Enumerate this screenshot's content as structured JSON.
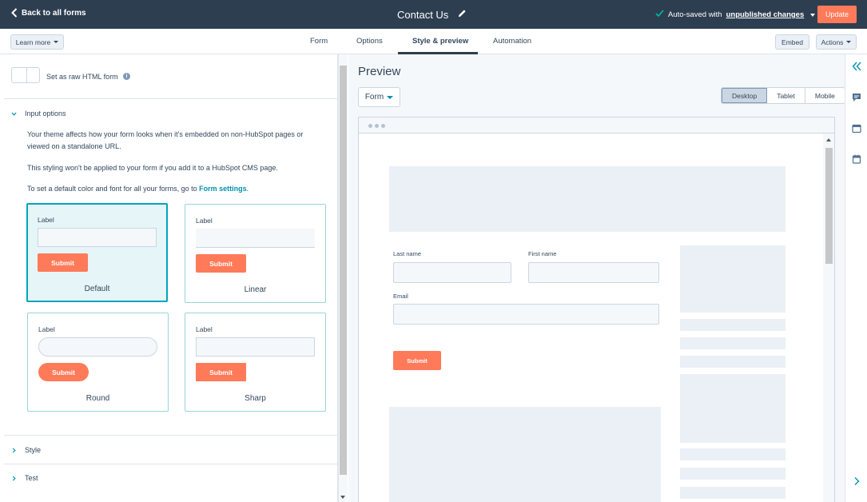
{
  "topbar": {
    "back_label": "Back to all forms",
    "title": "Contact Us",
    "autosave_prefix": "Auto-saved with",
    "autosave_link": "unpublished changes",
    "update_label": "Update"
  },
  "tabbar": {
    "learn_more": "Learn more",
    "tabs": [
      "Form",
      "Options",
      "Style & preview",
      "Automation"
    ],
    "active_tab": "Style & preview",
    "embed": "Embed",
    "actions": "Actions"
  },
  "left": {
    "raw_html_label": "Set as raw HTML form",
    "input_options": "Input options",
    "desc1": "Your theme affects how your form looks when it's embedded on non-HubSpot pages or viewed on a standalone URL.",
    "desc2": "This styling won't be applied to your form if you add it to a HubSpot CMS page.",
    "desc3_prefix": "To set a default color and font for all your forms, go to",
    "desc3_link": "Form settings",
    "desc3_suffix": ".",
    "cards": [
      {
        "label": "Label",
        "submit": "Submit",
        "name": "Default"
      },
      {
        "label": "Label",
        "submit": "Submit",
        "name": "Linear"
      },
      {
        "label": "Label",
        "submit": "Submit",
        "name": "Round"
      },
      {
        "label": "Label",
        "submit": "Submit",
        "name": "Sharp"
      }
    ],
    "style": "Style",
    "test": "Test"
  },
  "preview": {
    "title": "Preview",
    "form_dd": "Form",
    "devices": [
      "Desktop",
      "Tablet",
      "Mobile"
    ],
    "active_device": "Desktop",
    "last_name": "Last name",
    "first_name": "First name",
    "email": "Email",
    "submit": "Submit"
  },
  "colors": {
    "topbar": "#2d3e50",
    "accent": "#ff7a59",
    "selected_border": "#00a4bd",
    "link": "#0091ae"
  }
}
